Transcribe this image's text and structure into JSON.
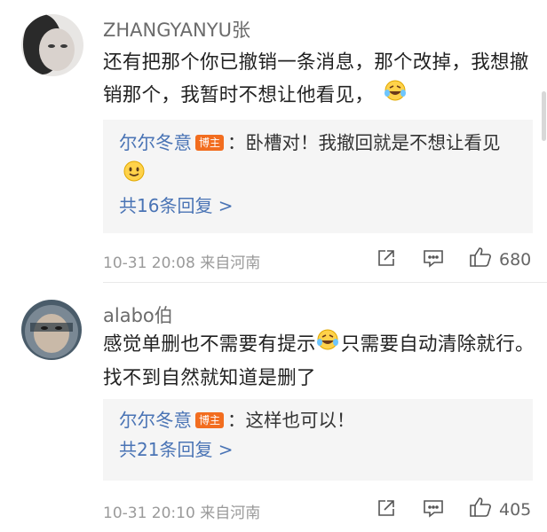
{
  "comments": [
    {
      "username": "ZHANGYANYU张",
      "body": "还有把那个你已撤销一条消息，那个改掉，我想撤销那个，我暂时不想让他看见，",
      "body_emoji": "laughing-crying-emoji",
      "reply": {
        "author": "尔尔冬意",
        "badge": "博主",
        "text": "：卧槽对！我撤回就是不想让看见",
        "text_emoji": "smile-emoji"
      },
      "more_replies": "共16条回复 >",
      "timestamp": "10-31 20:08",
      "location": "来自河南",
      "likes": "680"
    },
    {
      "username": "alabo伯",
      "body_before": "感觉单删也不需要有提示",
      "body_emoji": "laughing-crying-emoji",
      "body_after": "只需要自动清除就行。找不到自然就知道是删了",
      "reply": {
        "author": "尔尔冬意",
        "badge": "博主",
        "text": "：这样也可以！"
      },
      "more_replies": "共21条回复 >",
      "timestamp": "10-31 20:10",
      "location": "来自河南",
      "likes": "405"
    }
  ],
  "colors": {
    "link": "#4a74b5",
    "badge": "#f26d1f",
    "meta": "#9a9a9a",
    "reply_bg": "#f5f5f5"
  }
}
